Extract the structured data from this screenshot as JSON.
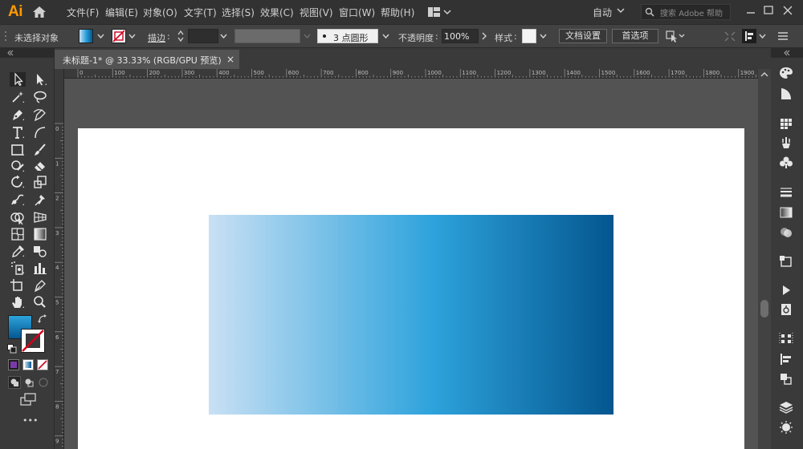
{
  "app": {
    "logo": "Ai"
  },
  "menu": [
    "文件(F)",
    "编辑(E)",
    "对象(O)",
    "文字(T)",
    "选择(S)",
    "效果(C)",
    "视图(V)",
    "窗口(W)",
    "帮助(H)"
  ],
  "workspace": {
    "label": "自动"
  },
  "search": {
    "placeholder": "搜索 Adobe 帮助"
  },
  "control_bar": {
    "selection_status": "未选择对象",
    "stroke_label": "描边",
    "brush_label": "3 点圆形",
    "opacity_label": "不透明度",
    "opacity_value": "100%",
    "style_label": "样式",
    "document_setup": "文档设置",
    "preferences": "首选项"
  },
  "document_tab": {
    "title": "未标题-1* @ 33.33% (RGB/GPU 预览)",
    "close": "×"
  },
  "ruler_h_labels": [
    "0",
    "100",
    "200",
    "300",
    "400",
    "500",
    "600",
    "700",
    "800",
    "900",
    "1000",
    "1100",
    "1200",
    "1300",
    "1400",
    "1500",
    "1600",
    "1700",
    "1800",
    "1900"
  ],
  "ruler_v_labels": [
    "0",
    "1",
    "2",
    "3",
    "4",
    "5",
    "6",
    "7",
    "8",
    "9"
  ],
  "toolbar": {
    "more": "•••"
  },
  "colors": {
    "gradient_start": "#c9e0f4",
    "gradient_mid": "#2ea3dc",
    "gradient_end": "#04568f",
    "accent": "#ff9a00"
  },
  "icons": {
    "tools": [
      "selection-tool-icon",
      "direct-selection-tool-icon",
      "magic-wand-icon",
      "lasso-icon",
      "pen-tool-icon",
      "curvature-tool-icon",
      "type-tool-icon",
      "arc-tool-icon",
      "rectangle-tool-icon",
      "paintbrush-icon",
      "shaper-tool-icon",
      "eraser-icon",
      "rotate-tool-icon",
      "scale-tool-icon",
      "warp-tool-icon",
      "puppet-warp-icon",
      "shape-builder-icon",
      "perspective-grid-icon",
      "mesh-tool-icon",
      "gradient-tool-icon",
      "eyedropper-icon",
      "blend-tool-icon",
      "symbol-sprayer-icon",
      "column-graph-icon",
      "artboard-tool-icon",
      "slice-tool-icon",
      "hand-tool-icon",
      "zoom-tool-icon"
    ],
    "right_panel": [
      "color-guide-icon",
      "properties-icon",
      "swatches-icon",
      "brushes-icon",
      "symbols-icon",
      "stroke-icon",
      "gradient-icon",
      "transparency-icon",
      "appearance-icon",
      "actions-icon",
      "links-icon",
      "align-icon",
      "pathfinder-icon",
      "transform-icon",
      "layers-icon",
      "artboards-icon"
    ]
  }
}
